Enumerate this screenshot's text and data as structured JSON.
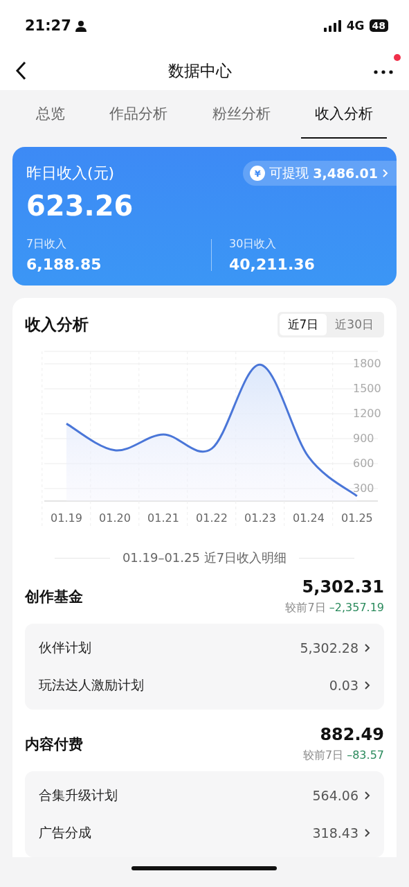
{
  "status_bar": {
    "time": "21:27",
    "network": "4G",
    "battery": "48"
  },
  "nav": {
    "title": "数据中心",
    "notification": true
  },
  "tabs": [
    {
      "label": "总览",
      "selected": false
    },
    {
      "label": "作品分析",
      "selected": false
    },
    {
      "label": "粉丝分析",
      "selected": false
    },
    {
      "label": "收入分析",
      "selected": true
    }
  ],
  "summary": {
    "title": "昨日收入(元)",
    "amount": "623.26",
    "withdraw": {
      "icon": "¥",
      "label": "可提现",
      "amount": "3,486.01"
    },
    "stats": [
      {
        "label": "7日收入",
        "value": "6,188.85"
      },
      {
        "label": "30日收入",
        "value": "40,211.36"
      }
    ]
  },
  "analysis": {
    "title": "收入分析",
    "ranges": [
      {
        "label": "近7日",
        "selected": true
      },
      {
        "label": "近30日",
        "selected": false
      }
    ],
    "chart_data": {
      "type": "area",
      "categories": [
        "01.19",
        "01.20",
        "01.21",
        "01.22",
        "01.23",
        "01.24",
        "01.25"
      ],
      "grid": true,
      "ylim": [
        150,
        1950
      ],
      "yticks": [
        300,
        600,
        900,
        1200,
        1500,
        1800
      ],
      "series": [
        {
          "color": "#4a76d8",
          "values": [
            1080,
            760,
            950,
            780,
            1790,
            680,
            210
          ]
        }
      ]
    }
  },
  "detail_caption": "01.19–01.25 近7日收入明细",
  "groups": [
    {
      "name": "创作基金",
      "amount": "5,302.31",
      "compare_label": "较前7日",
      "change": "–2,357.19",
      "items": [
        {
          "name": "伙伴计划",
          "value": "5,302.28"
        },
        {
          "name": "玩法达人激励计划",
          "value": "0.03"
        }
      ]
    },
    {
      "name": "内容付费",
      "amount": "882.49",
      "compare_label": "较前7日",
      "change": "–83.57",
      "items": [
        {
          "name": "合集升级计划",
          "value": "564.06"
        },
        {
          "name": "广告分成",
          "value": "318.43"
        }
      ]
    }
  ]
}
